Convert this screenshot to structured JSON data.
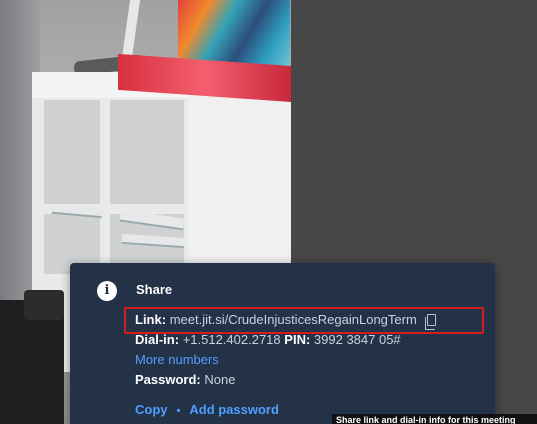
{
  "share": {
    "title": "Share",
    "info_icon": "i",
    "link_label": "Link:",
    "link_value": "meet.jit.si/CrudeInjusticesRegainLongTerm",
    "dialin_label": "Dial-in:",
    "dialin_value": "+1.512.402.2718",
    "pin_label": "PIN:",
    "pin_value": "3992 3847 05#",
    "more_numbers": "More numbers",
    "password_label": "Password:",
    "password_value": "None",
    "copy_label": "Copy",
    "separator": "•",
    "add_password_label": "Add password"
  },
  "tooltip": {
    "text": "Share link and dial-in info for this meeting"
  },
  "icons": {
    "info": "info-icon",
    "copy": "copy-icon"
  },
  "colors": {
    "panel_bg": "#243247",
    "link_blue": "#4e9fff",
    "highlight_red": "#d81c1c",
    "stage_bg": "#474747"
  }
}
